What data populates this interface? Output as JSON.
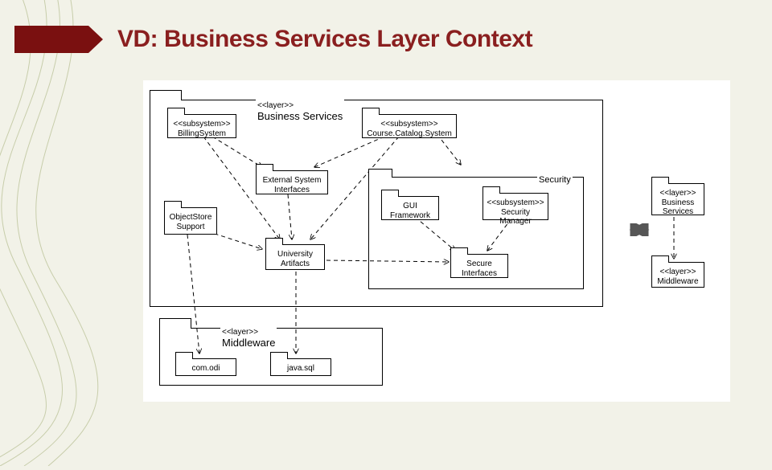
{
  "title": "VD: Business Services Layer Context",
  "layers": {
    "business_services": {
      "stereo": "<<layer>>",
      "name": "Business Services"
    },
    "middleware": {
      "stereo": "<<layer>>",
      "name": "Middleware"
    },
    "security": {
      "name": "Security"
    }
  },
  "packages": {
    "billing": {
      "stereo": "<<subsystem>>",
      "name": "BillingSystem"
    },
    "catalog": {
      "stereo": "<<subsystem>>",
      "name": "Course.Catalog.System"
    },
    "extsys": {
      "name": "External System\nInterfaces"
    },
    "objstore": {
      "name": "ObjectStore\nSupport"
    },
    "guifw": {
      "name": "GUI\nFramework"
    },
    "secmgr": {
      "stereo": "<<subsystem>>",
      "name": "Security\nManager"
    },
    "univart": {
      "name": "University\nArtifacts"
    },
    "secif": {
      "name": "Secure\nInterfaces"
    },
    "comodi": {
      "name": "com.odi"
    },
    "javasql": {
      "name": "java.sql"
    }
  },
  "side": {
    "bs": {
      "stereo": "<<layer>>",
      "name": "Business\nServices"
    },
    "mw": {
      "stereo": "<<layer>>",
      "name": "Middleware"
    }
  },
  "chart_data": {
    "type": "diagram",
    "nodes": [
      {
        "id": "BusinessServicesLayer",
        "stereotype": "layer",
        "contains": [
          "BillingSystem",
          "CourseCatalogSystem",
          "ExternalSystemInterfaces",
          "ObjectStoreSupport",
          "GUIFramework",
          "SecurityManager",
          "UniversityArtifacts",
          "SecureInterfaces",
          "Security"
        ]
      },
      {
        "id": "MiddlewareLayer",
        "stereotype": "layer",
        "contains": [
          "com.odi",
          "java.sql"
        ]
      },
      {
        "id": "BillingSystem",
        "stereotype": "subsystem"
      },
      {
        "id": "CourseCatalogSystem",
        "stereotype": "subsystem"
      },
      {
        "id": "ExternalSystemInterfaces"
      },
      {
        "id": "ObjectStoreSupport"
      },
      {
        "id": "Security",
        "contains": [
          "GUIFramework",
          "SecurityManager",
          "SecureInterfaces"
        ]
      },
      {
        "id": "GUIFramework"
      },
      {
        "id": "SecurityManager",
        "stereotype": "subsystem"
      },
      {
        "id": "UniversityArtifacts"
      },
      {
        "id": "SecureInterfaces"
      },
      {
        "id": "com.odi"
      },
      {
        "id": "java.sql"
      },
      {
        "id": "BusinessServicesLayerSide",
        "stereotype": "layer"
      },
      {
        "id": "MiddlewareLayerSide",
        "stereotype": "layer"
      }
    ],
    "edges": [
      {
        "from": "BillingSystem",
        "to": "ExternalSystemInterfaces",
        "style": "dashed"
      },
      {
        "from": "CourseCatalogSystem",
        "to": "ExternalSystemInterfaces",
        "style": "dashed"
      },
      {
        "from": "BillingSystem",
        "to": "UniversityArtifacts",
        "style": "dashed"
      },
      {
        "from": "CourseCatalogSystem",
        "to": "UniversityArtifacts",
        "style": "dashed"
      },
      {
        "from": "CourseCatalogSystem",
        "to": "Security",
        "style": "dashed"
      },
      {
        "from": "ExternalSystemInterfaces",
        "to": "UniversityArtifacts",
        "style": "dashed"
      },
      {
        "from": "ObjectStoreSupport",
        "to": "UniversityArtifacts",
        "style": "dashed"
      },
      {
        "from": "GUIFramework",
        "to": "SecureInterfaces",
        "style": "dashed"
      },
      {
        "from": "SecurityManager",
        "to": "SecureInterfaces",
        "style": "dashed"
      },
      {
        "from": "UniversityArtifacts",
        "to": "SecureInterfaces",
        "style": "dashed"
      },
      {
        "from": "ObjectStoreSupport",
        "to": "com.odi",
        "style": "dashed"
      },
      {
        "from": "UniversityArtifacts",
        "to": "java.sql",
        "style": "dashed"
      },
      {
        "from": "BusinessServicesLayerSide",
        "to": "MiddlewareLayerSide",
        "style": "dashed"
      },
      {
        "from": "BusinessServicesLayer",
        "to": "BusinessServicesLayerSide",
        "style": "bidirectional"
      }
    ]
  }
}
